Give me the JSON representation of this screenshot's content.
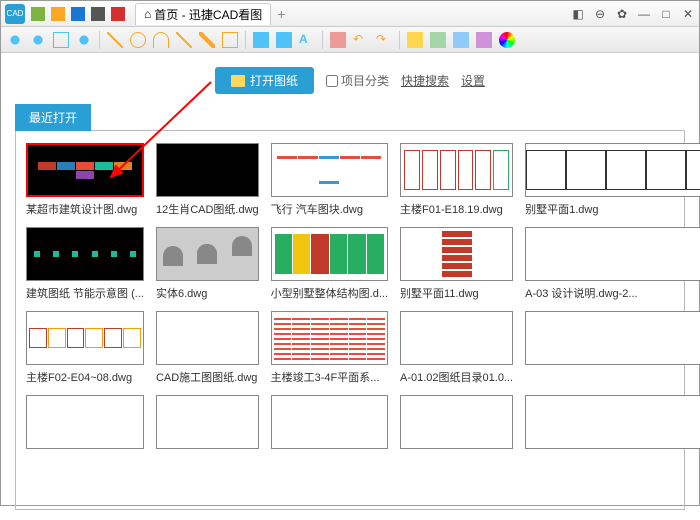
{
  "titlebar": {
    "tab_home_icon": "⌂",
    "tab_title": "首页 - 迅捷CAD看图"
  },
  "actions": {
    "open_button": "打开图纸",
    "category_label": "项目分类",
    "quick_search": "快捷搜索",
    "settings": "设置"
  },
  "section": {
    "recent_label": "最近打开"
  },
  "files": [
    {
      "name": "某超市建筑设计图.dwg",
      "thumb": "t1",
      "selected": true
    },
    {
      "name": "12生肖CAD图纸.dwg",
      "thumb": "t2"
    },
    {
      "name": "飞行 汽车图块.dwg",
      "thumb": "t3"
    },
    {
      "name": "主楼F01-E18.19.dwg",
      "thumb": "t4"
    },
    {
      "name": "别墅平面1.dwg",
      "thumb": "t5"
    },
    {
      "name": "建筑图纸 节能示意图 (...",
      "thumb": "t6"
    },
    {
      "name": "实体6.dwg",
      "thumb": "t7"
    },
    {
      "name": "小型别墅整体结构图.d...",
      "thumb": "t8"
    },
    {
      "name": "别墅平面11.dwg",
      "thumb": "t9"
    },
    {
      "name": "A-03 设计说明.dwg-2...",
      "thumb": ""
    },
    {
      "name": "主楼F02-E04~08.dwg",
      "thumb": "t10"
    },
    {
      "name": "CAD施工图图纸.dwg",
      "thumb": ""
    },
    {
      "name": "主楼竣工3-4F平面系...",
      "thumb": "t11"
    },
    {
      "name": "A-01.02图纸目录01.0...",
      "thumb": ""
    },
    {
      "name": "",
      "thumb": ""
    },
    {
      "name": "",
      "thumb": ""
    },
    {
      "name": "",
      "thumb": ""
    },
    {
      "name": "",
      "thumb": ""
    },
    {
      "name": "",
      "thumb": ""
    },
    {
      "name": "",
      "thumb": ""
    }
  ]
}
